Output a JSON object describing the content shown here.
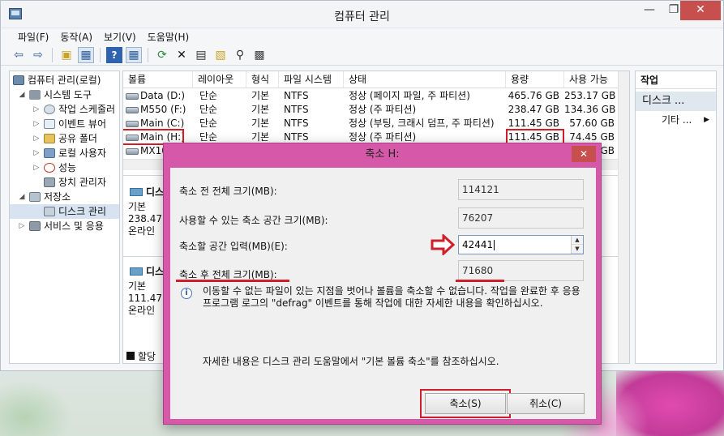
{
  "window": {
    "title": "컴퓨터 관리",
    "min": "—",
    "max": "❐",
    "close": "✕"
  },
  "menu": [
    "파일(F)",
    "동작(A)",
    "보기(V)",
    "도움말(H)"
  ],
  "toolbar": [
    {
      "name": "back-icon",
      "glyph": "⇦"
    },
    {
      "name": "forward-icon",
      "glyph": "⇨"
    },
    {
      "name": "up-folder-icon",
      "glyph": "▣"
    },
    {
      "name": "show-hide-tree-icon",
      "glyph": "▦"
    },
    {
      "name": "help-icon",
      "glyph": "?"
    },
    {
      "name": "console-icon",
      "glyph": "▦"
    },
    {
      "name": "refresh-icon",
      "glyph": "⟳"
    },
    {
      "name": "delete-icon",
      "glyph": "✕"
    },
    {
      "name": "properties-icon",
      "glyph": "▤"
    },
    {
      "name": "open-folder-icon",
      "glyph": "▧"
    },
    {
      "name": "search-icon",
      "glyph": "⚲"
    },
    {
      "name": "export-icon",
      "glyph": "▩"
    }
  ],
  "tree": [
    {
      "label": "컴퓨터 관리(로컬)",
      "indent": 0,
      "arrow": "",
      "icon": "computer"
    },
    {
      "label": "시스템 도구",
      "indent": 1,
      "arrow": "◢",
      "icon": "tools"
    },
    {
      "label": "작업 스케줄러",
      "indent": 2,
      "arrow": "▷",
      "icon": "clock"
    },
    {
      "label": "이벤트 뷰어",
      "indent": 2,
      "arrow": "▷",
      "icon": "event"
    },
    {
      "label": "공유 폴더",
      "indent": 2,
      "arrow": "▷",
      "icon": "folder"
    },
    {
      "label": "로컬 사용자",
      "indent": 2,
      "arrow": "▷",
      "icon": "users"
    },
    {
      "label": "성능",
      "indent": 2,
      "arrow": "▷",
      "icon": "perf"
    },
    {
      "label": "장치 관리자",
      "indent": 2,
      "arrow": "",
      "icon": "device"
    },
    {
      "label": "저장소",
      "indent": 1,
      "arrow": "◢",
      "icon": "storage"
    },
    {
      "label": "디스크 관리",
      "indent": 2,
      "arrow": "",
      "icon": "disk",
      "selected": true
    },
    {
      "label": "서비스 및 응용",
      "indent": 1,
      "arrow": "▷",
      "icon": "services"
    }
  ],
  "volume_table": {
    "columns": [
      "볼륨",
      "레이아웃",
      "형식",
      "파일 시스템",
      "상태",
      "용량",
      "사용 가능"
    ],
    "rows": [
      {
        "volume": "Data (D:)",
        "layout": "단순",
        "type": "기본",
        "fs": "NTFS",
        "status": "정상 (페이지 파일, 주 파티션)",
        "capacity": "465.76 GB",
        "free": "253.17 GB"
      },
      {
        "volume": "M550 (F:)",
        "layout": "단순",
        "type": "기본",
        "fs": "NTFS",
        "status": "정상 (주 파티션)",
        "capacity": "238.47 GB",
        "free": "134.36 GB"
      },
      {
        "volume": "Main (C:)",
        "layout": "단순",
        "type": "기본",
        "fs": "NTFS",
        "status": "정상 (부팅, 크래시 덤프, 주 파티션)",
        "capacity": "111.45 GB",
        "free": "57.60 GB"
      },
      {
        "volume": "Main (H:)",
        "layout": "단순",
        "type": "기본",
        "fs": "NTFS",
        "status": "정상 (주 파티션)",
        "capacity": "111.45 GB",
        "free": "74.45 GB"
      },
      {
        "volume": "MX10",
        "layout": "",
        "type": "",
        "fs": "",
        "status": "",
        "capacity": "",
        "free": "GB"
      }
    ]
  },
  "disk_cards": [
    {
      "title": "디스",
      "kind": "기본",
      "size": "238.47",
      "state": "온라인"
    },
    {
      "title": "디스",
      "kind": "기본",
      "size": "111.47",
      "state": "온라인"
    }
  ],
  "legend_fragment": "할당",
  "actions": {
    "header": "작업",
    "section": "디스크 ...",
    "item": "기타 ..."
  },
  "dialog": {
    "title": "축소 H:",
    "close": "✕",
    "total_before_label": "축소 전 전체 크기(MB):",
    "total_before_value": "114121",
    "available_label": "사용할 수 있는 축소 공간 크기(MB):",
    "available_value": "76207",
    "shrink_label": "축소할 공간 입력(MB)(E):",
    "shrink_value": "42441",
    "total_after_label": "축소 후 전체 크기(MB):",
    "total_after_value": "71680",
    "info_text": "이동할 수 없는 파일이 있는 지점을 벗어나 볼륨을 축소할 수 없습니다. 작업을 완료한 후 응용 프로그램 로그의 \"defrag\" 이벤트를 통해 작업에 대한 자세한 내용을 확인하십시오.",
    "help_text": "자세한 내용은 디스크 관리 도움말에서 \"기본 볼륨 축소\"를 참조하십시오.",
    "shrink_button": "축소(S)",
    "cancel_button": "취소(C)"
  },
  "colors": {
    "highlight_red": "#d01f2a",
    "dialog_frame": "#d659a9",
    "close_red": "#c7504f"
  }
}
